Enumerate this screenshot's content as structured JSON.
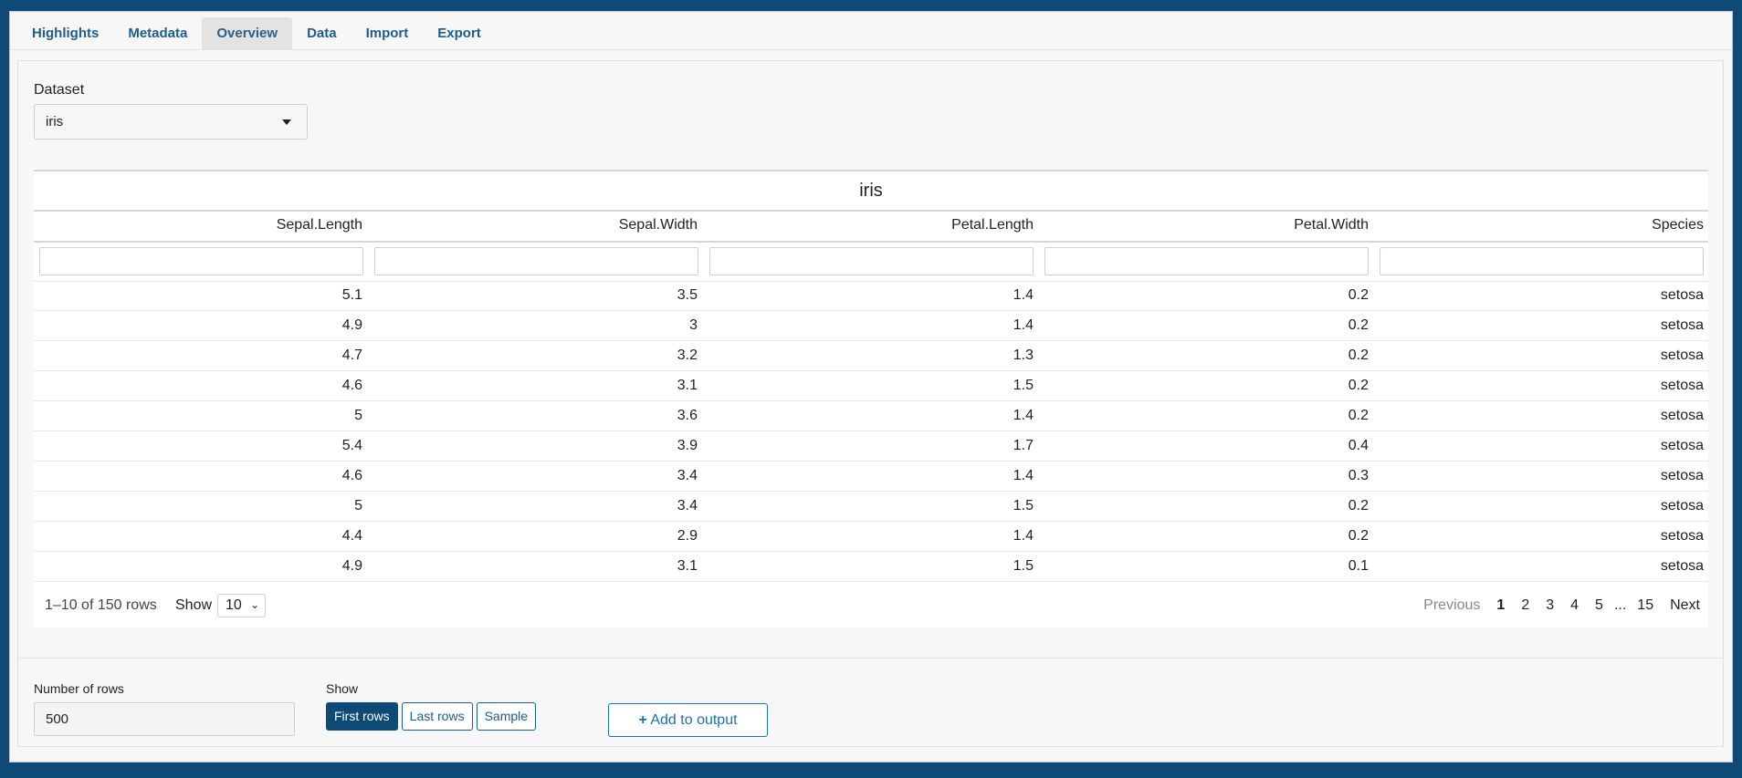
{
  "tabs": [
    {
      "label": "Highlights"
    },
    {
      "label": "Metadata"
    },
    {
      "label": "Overview"
    },
    {
      "label": "Data"
    },
    {
      "label": "Import"
    },
    {
      "label": "Export"
    }
  ],
  "active_tab": "Overview",
  "dataset": {
    "label": "Dataset",
    "value": "iris"
  },
  "table": {
    "caption": "iris",
    "columns": [
      "Sepal.Length",
      "Sepal.Width",
      "Petal.Length",
      "Petal.Width",
      "Species"
    ],
    "rows": [
      [
        "5.1",
        "3.5",
        "1.4",
        "0.2",
        "setosa"
      ],
      [
        "4.9",
        "3",
        "1.4",
        "0.2",
        "setosa"
      ],
      [
        "4.7",
        "3.2",
        "1.3",
        "0.2",
        "setosa"
      ],
      [
        "4.6",
        "3.1",
        "1.5",
        "0.2",
        "setosa"
      ],
      [
        "5",
        "3.6",
        "1.4",
        "0.2",
        "setosa"
      ],
      [
        "5.4",
        "3.9",
        "1.7",
        "0.4",
        "setosa"
      ],
      [
        "4.6",
        "3.4",
        "1.4",
        "0.3",
        "setosa"
      ],
      [
        "5",
        "3.4",
        "1.5",
        "0.2",
        "setosa"
      ],
      [
        "4.4",
        "2.9",
        "1.4",
        "0.2",
        "setosa"
      ],
      [
        "4.9",
        "3.1",
        "1.5",
        "0.1",
        "setosa"
      ]
    ],
    "range_text": "1–10 of 150 rows",
    "show_label": "Show",
    "page_size": "10",
    "pager": {
      "previous": "Previous",
      "pages": [
        "1",
        "2",
        "3",
        "4",
        "5"
      ],
      "ellipsis": "...",
      "last": "15",
      "next": "Next",
      "current": "1"
    }
  },
  "controls": {
    "nrows_label": "Number of rows",
    "nrows_value": "500",
    "show_label": "Show",
    "show_buttons": [
      {
        "label": "First rows",
        "active": true
      },
      {
        "label": "Last rows",
        "active": false
      },
      {
        "label": "Sample",
        "active": false
      }
    ],
    "add_button": {
      "icon": "plus-icon",
      "label": "Add to output"
    }
  },
  "colors": {
    "accent": "#0d4a75",
    "link": "#1b5e8c"
  }
}
